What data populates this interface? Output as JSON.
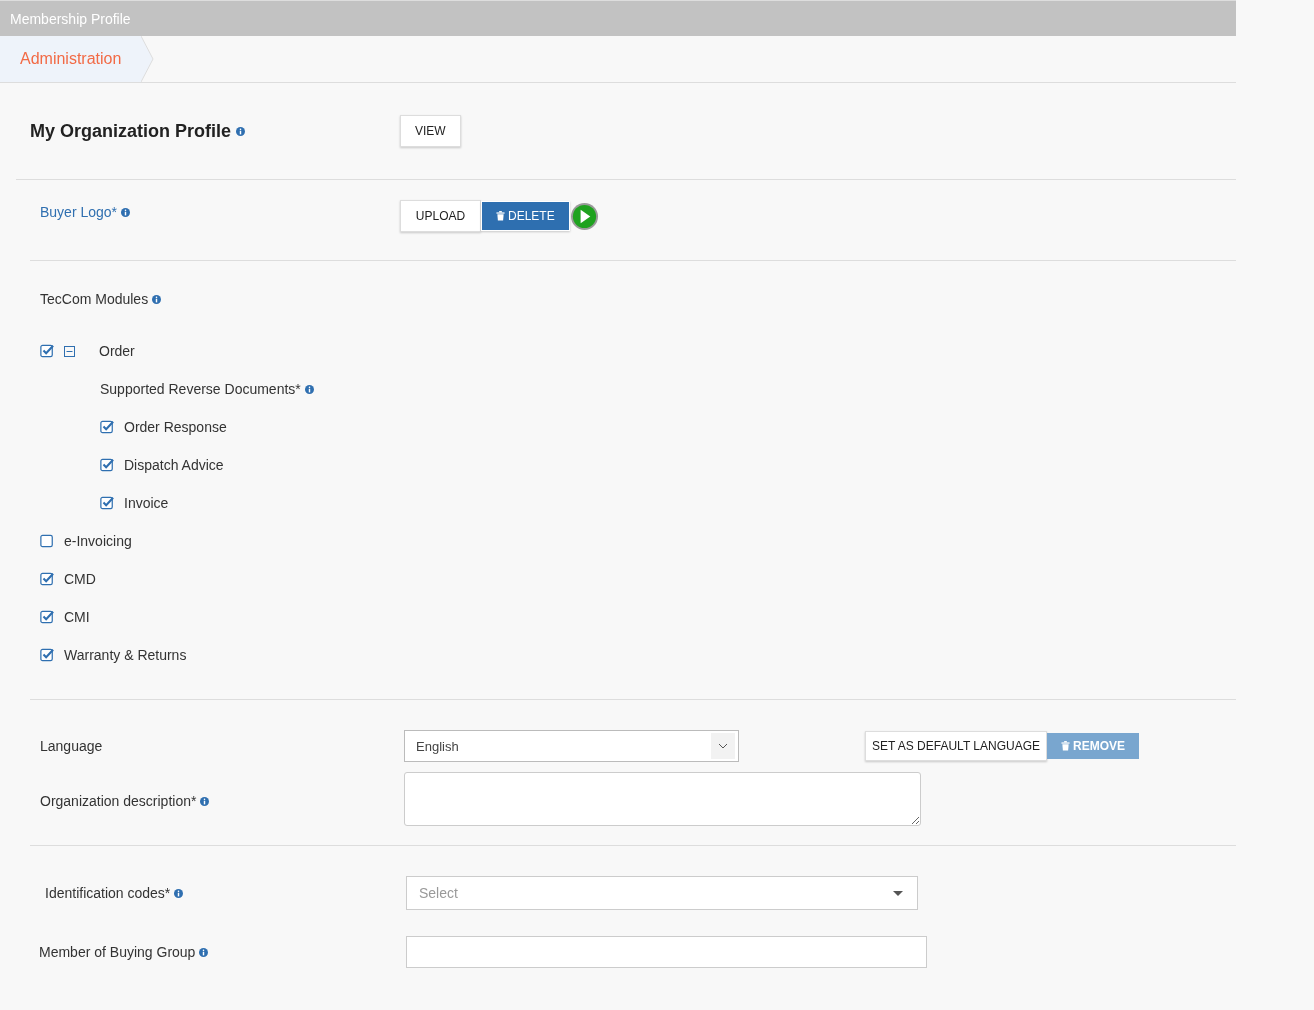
{
  "header": {
    "title": "Membership Profile"
  },
  "breadcrumb": {
    "label": "Administration"
  },
  "profile": {
    "title": "My Organization Profile",
    "view_button": "VIEW"
  },
  "buyer_logo": {
    "label": "Buyer Logo*",
    "upload_button": "UPLOAD",
    "delete_button": "DELETE"
  },
  "modules": {
    "label": "TecCom Modules",
    "items": [
      {
        "label": "Order",
        "checked": true,
        "expanded": true,
        "subheading": "Supported Reverse Documents*",
        "children": [
          {
            "label": "Order Response",
            "checked": true
          },
          {
            "label": "Dispatch Advice",
            "checked": true
          },
          {
            "label": "Invoice",
            "checked": true
          }
        ]
      },
      {
        "label": "e-Invoicing",
        "checked": false
      },
      {
        "label": "CMD",
        "checked": true
      },
      {
        "label": "CMI",
        "checked": true
      },
      {
        "label": "Warranty & Returns",
        "checked": true
      }
    ]
  },
  "language": {
    "label": "Language",
    "value": "English",
    "set_default_button": "SET AS DEFAULT LANGUAGE",
    "remove_button": "REMOVE"
  },
  "description": {
    "label": "Organization description*"
  },
  "identification_codes": {
    "label": "Identification codes*",
    "placeholder": "Select"
  },
  "buying_group": {
    "label": "Member of Buying Group"
  }
}
